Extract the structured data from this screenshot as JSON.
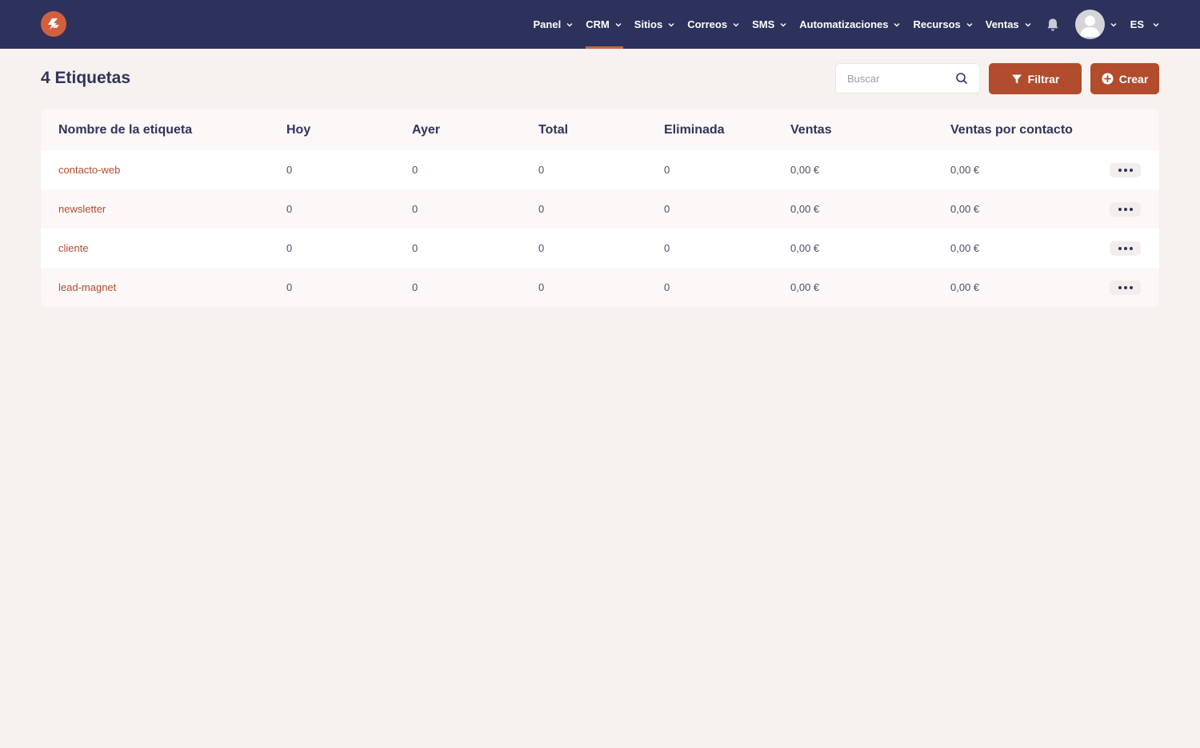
{
  "nav": {
    "items": [
      {
        "label": "Panel",
        "active": false
      },
      {
        "label": "CRM",
        "active": true
      },
      {
        "label": "Sitios",
        "active": false
      },
      {
        "label": "Correos",
        "active": false
      },
      {
        "label": "SMS",
        "active": false
      },
      {
        "label": "Automatizaciones",
        "active": false
      },
      {
        "label": "Recursos",
        "active": false
      },
      {
        "label": "Ventas",
        "active": false
      }
    ],
    "language": "ES"
  },
  "page": {
    "title": "4 Etiquetas"
  },
  "search": {
    "placeholder": "Buscar"
  },
  "toolbar": {
    "filter_label": "Filtrar",
    "create_label": "Crear"
  },
  "table": {
    "columns": [
      "Nombre de la etiqueta",
      "Hoy",
      "Ayer",
      "Total",
      "Eliminada",
      "Ventas",
      "Ventas por contacto"
    ],
    "rows": [
      {
        "name": "contacto-web",
        "hoy": "0",
        "ayer": "0",
        "total": "0",
        "eliminada": "0",
        "ventas": "0,00 €",
        "ventas_contacto": "0,00 €"
      },
      {
        "name": "newsletter",
        "hoy": "0",
        "ayer": "0",
        "total": "0",
        "eliminada": "0",
        "ventas": "0,00 €",
        "ventas_contacto": "0,00 €"
      },
      {
        "name": "cliente",
        "hoy": "0",
        "ayer": "0",
        "total": "0",
        "eliminada": "0",
        "ventas": "0,00 €",
        "ventas_contacto": "0,00 €"
      },
      {
        "name": "lead-magnet",
        "hoy": "0",
        "ayer": "0",
        "total": "0",
        "eliminada": "0",
        "ventas": "0,00 €",
        "ventas_contacto": "0,00 €"
      }
    ]
  },
  "colors": {
    "navbar": "#2c325b",
    "accent": "#d2603f",
    "button": "#b14c2d",
    "background": "#f7f2ef"
  }
}
